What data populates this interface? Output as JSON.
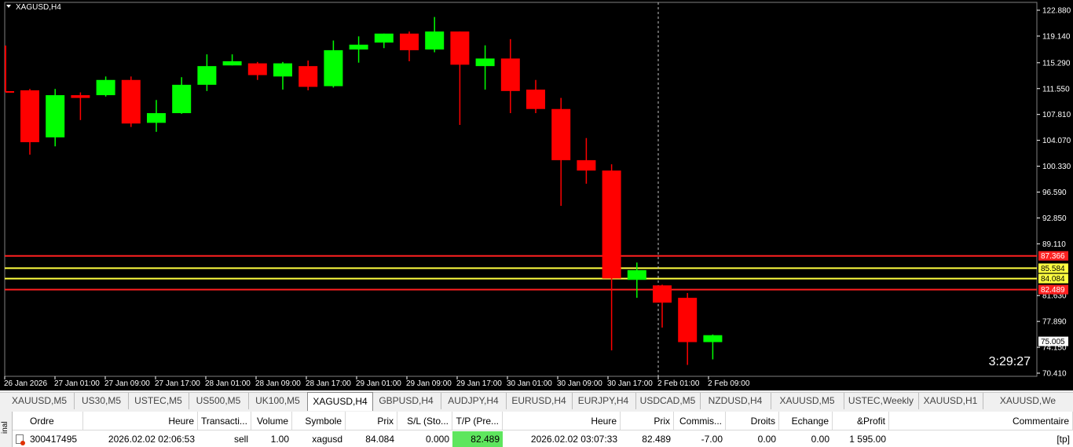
{
  "chart": {
    "title": "XAGUSD,H4",
    "countdown": "3:29:27",
    "price_axis": [
      "122.880",
      "119.140",
      "115.290",
      "111.550",
      "107.810",
      "104.070",
      "100.330",
      "96.590",
      "92.850",
      "89.110",
      "81.630",
      "77.890",
      "74.150",
      "70.410"
    ],
    "time_axis": [
      "26 Jan 2026",
      "27 Jan 01:00",
      "27 Jan 09:00",
      "27 Jan 17:00",
      "28 Jan 01:00",
      "28 Jan 09:00",
      "28 Jan 17:00",
      "29 Jan 01:00",
      "29 Jan 09:00",
      "29 Jan 17:00",
      "30 Jan 01:00",
      "30 Jan 09:00",
      "30 Jan 17:00",
      "2 Feb 01:00",
      "2 Feb 09:00"
    ],
    "level_labels": [
      {
        "value": "87.366",
        "color": "#ff2020",
        "text_color": "#ffffff"
      },
      {
        "value": "85.584",
        "color": "#ffff40",
        "text_color": "#000000"
      },
      {
        "value": "84.084",
        "color": "#ffff40",
        "text_color": "#000000"
      },
      {
        "value": "82.489",
        "color": "#ff2020",
        "text_color": "#ffffff"
      },
      {
        "value": "75.005",
        "color": "#ffffff",
        "text_color": "#000000"
      }
    ],
    "colors": {
      "bull": "#00ff00",
      "bear": "#ff0000",
      "background": "#000000",
      "axis_text": "#ffffff"
    }
  },
  "chart_data": {
    "type": "candlestick",
    "symbol": "XAGUSD",
    "timeframe": "H4",
    "price_levels": [
      87.366,
      85.584,
      84.084,
      82.489
    ],
    "current_price": 75.005,
    "candles": [
      {
        "o": 111.3,
        "h": 111.5,
        "l": 102.0,
        "c": 103.8
      },
      {
        "o": 104.5,
        "h": 111.5,
        "l": 103.2,
        "c": 110.6
      },
      {
        "o": 110.6,
        "h": 111.0,
        "l": 107.0,
        "c": 110.2
      },
      {
        "o": 110.6,
        "h": 113.3,
        "l": 110.4,
        "c": 112.8
      },
      {
        "o": 112.8,
        "h": 113.3,
        "l": 106.0,
        "c": 106.5
      },
      {
        "o": 106.6,
        "h": 109.9,
        "l": 105.3,
        "c": 108.0
      },
      {
        "o": 108.0,
        "h": 113.2,
        "l": 107.9,
        "c": 112.1
      },
      {
        "o": 112.1,
        "h": 116.5,
        "l": 111.2,
        "c": 114.8
      },
      {
        "o": 114.9,
        "h": 116.5,
        "l": 114.9,
        "c": 115.5
      },
      {
        "o": 115.2,
        "h": 115.4,
        "l": 112.8,
        "c": 113.5
      },
      {
        "o": 113.3,
        "h": 115.4,
        "l": 111.4,
        "c": 115.2
      },
      {
        "o": 114.8,
        "h": 115.6,
        "l": 111.3,
        "c": 111.8
      },
      {
        "o": 111.9,
        "h": 118.5,
        "l": 111.7,
        "c": 117.1
      },
      {
        "o": 117.2,
        "h": 119.1,
        "l": 115.3,
        "c": 117.9
      },
      {
        "o": 118.2,
        "h": 119.5,
        "l": 117.4,
        "c": 119.5
      },
      {
        "o": 119.5,
        "h": 119.8,
        "l": 115.5,
        "c": 117.1
      },
      {
        "o": 117.2,
        "h": 121.9,
        "l": 116.8,
        "c": 119.8
      },
      {
        "o": 119.8,
        "h": 119.8,
        "l": 106.3,
        "c": 115.0
      },
      {
        "o": 114.8,
        "h": 117.8,
        "l": 111.4,
        "c": 115.9
      },
      {
        "o": 115.9,
        "h": 118.7,
        "l": 108.0,
        "c": 111.2
      },
      {
        "o": 111.4,
        "h": 112.8,
        "l": 108.0,
        "c": 108.6
      },
      {
        "o": 108.6,
        "h": 110.2,
        "l": 94.6,
        "c": 101.2
      },
      {
        "o": 101.2,
        "h": 104.4,
        "l": 97.8,
        "c": 99.7
      },
      {
        "o": 99.7,
        "h": 100.6,
        "l": 73.7,
        "c": 84.1
      },
      {
        "o": 83.9,
        "h": 86.4,
        "l": 81.3,
        "c": 85.3
      },
      {
        "o": 83.1,
        "h": 83.2,
        "l": 77.0,
        "c": 80.6
      },
      {
        "o": 81.3,
        "h": 82.0,
        "l": 71.6,
        "c": 74.9
      },
      {
        "o": 74.9,
        "h": 76.0,
        "l": 72.4,
        "c": 75.9
      }
    ]
  },
  "tabs": [
    "XAUUSD,M5",
    "US30,M5",
    "USTEC,M5",
    "US500,M5",
    "UK100,M5",
    "XAGUSD,H4",
    "GBPUSD,H4",
    "AUDJPY,H4",
    "EURUSD,H4",
    "EURJPY,H4",
    "USDCAD,M5",
    "NZDUSD,H4",
    "XAUUSD,M5",
    "USTEC,Weekly",
    "XAUUSD,H1",
    "XAUUSD,We"
  ],
  "terminal": {
    "side_label": "inal",
    "headers": [
      "Ordre",
      "Heure",
      "Transacti...",
      "Volume",
      "Symbole",
      "Prix",
      "S/L (Sto...",
      "T/P (Pre...",
      "Heure",
      "Prix",
      "Commis...",
      "Droits",
      "Echange",
      "&Profit",
      "Commentaire"
    ],
    "row": [
      "300417495",
      "2026.02.02 02:06:53",
      "sell",
      "1.00",
      "xagusd",
      "84.084",
      "0.000",
      "82.489",
      "2026.02.02 03:07:33",
      "82.489",
      "-7.00",
      "0.00",
      "0.00",
      "1 595.00",
      "[tp]"
    ]
  }
}
